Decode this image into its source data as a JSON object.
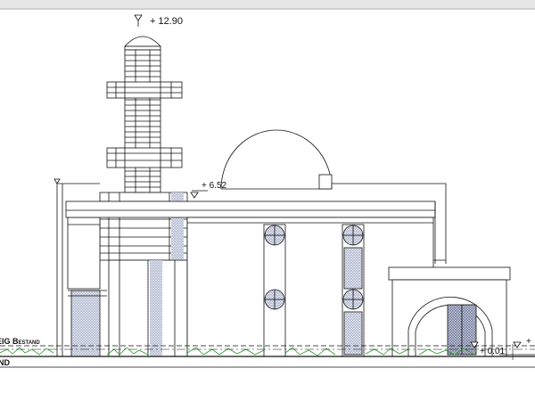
{
  "elevation_labels": {
    "top": "+ 12.90",
    "mid": "+ 6.52",
    "ground": "+ 0.01",
    "right_edge": "+"
  },
  "ground_labels": {
    "upper": "EIG Bestand",
    "lower": "ND"
  },
  "colors": {
    "sheet_border": "#c8c8c8",
    "paper": "#ffffff",
    "line": "#111111",
    "hatch": "#9aa3c0",
    "vegetation": "#2e9b2e"
  }
}
